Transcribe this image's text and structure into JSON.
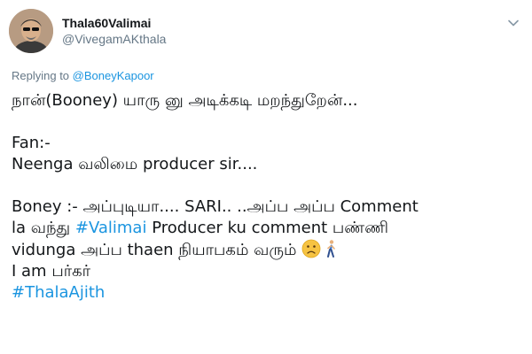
{
  "user": {
    "display_name": "Thala60Valimai",
    "handle": "@VivegamAKthala"
  },
  "reply": {
    "prefix": "Replying to ",
    "mention": "@BoneyKapoor"
  },
  "tweet": {
    "line1": "நான்(Booney) யாரு னு அடிக்கடி மறந்துறேன்...",
    "line2": "Fan:-",
    "line3": "Neenga வலிமை producer sir....",
    "line4": "Boney :- அப்புடியா.... SARI.. ..அப்ப அப்ப Comment",
    "line5_pre": "la வந்து ",
    "line5_tag": "#Valimai",
    "line5_post": " Producer ku comment பண்ணி",
    "line6": "vidunga அப்ப thaen நியாபகம் வரும் ",
    "line7": "I am பர்கர்",
    "hashtag_final": "#ThalaAjith"
  },
  "icons": {
    "caret": "chevron-down-icon",
    "frown": "frowning-face-emoji",
    "walk": "person-walking-emoji"
  },
  "colors": {
    "link": "#1b95e0",
    "muted": "#657786",
    "text": "#14171a"
  }
}
